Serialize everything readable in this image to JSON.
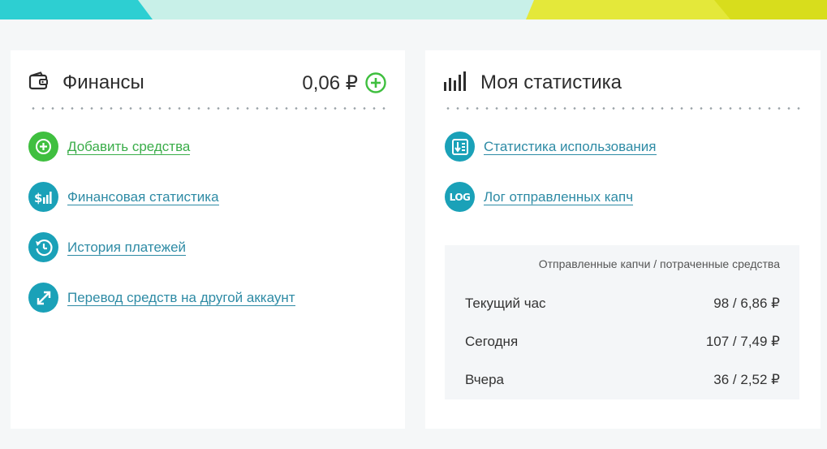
{
  "finance": {
    "title": "Финансы",
    "balance": "0,06 ₽",
    "links": [
      {
        "label": "Добавить средства",
        "icon": "plus-circle-icon",
        "color": "#3fbf3f"
      },
      {
        "label": "Финансовая статистика",
        "icon": "dollar-chart-icon",
        "color": "#1aa1b8"
      },
      {
        "label": "История платежей",
        "icon": "clock-history-icon",
        "color": "#1aa1b8"
      },
      {
        "label": "Перевод средств на другой аккаунт",
        "icon": "transfer-arrows-icon",
        "color": "#1aa1b8"
      }
    ]
  },
  "stats": {
    "title": "Моя статистика",
    "links": [
      {
        "label": "Статистика использования",
        "icon": "usage-stats-icon"
      },
      {
        "label": "Лог отправленных капч",
        "icon": "log-icon",
        "icon_text": "LOG"
      }
    ],
    "table": {
      "caption": "Отправленные капчи / потраченные средства",
      "rows": [
        {
          "period": "Текущий час",
          "value": "98 / 6,86 ₽"
        },
        {
          "period": "Сегодня",
          "value": "107 / 7,49 ₽"
        },
        {
          "period": "Вчера",
          "value": "36 / 2,52 ₽"
        }
      ]
    }
  },
  "colors": {
    "green": "#3fbf3f",
    "teal": "#1aa1b8",
    "link": "#2e8ba5",
    "bar_cyan": "#2dcfd2",
    "bar_mint": "#c8f0e8",
    "bar_yellow": "#e0e02a"
  }
}
